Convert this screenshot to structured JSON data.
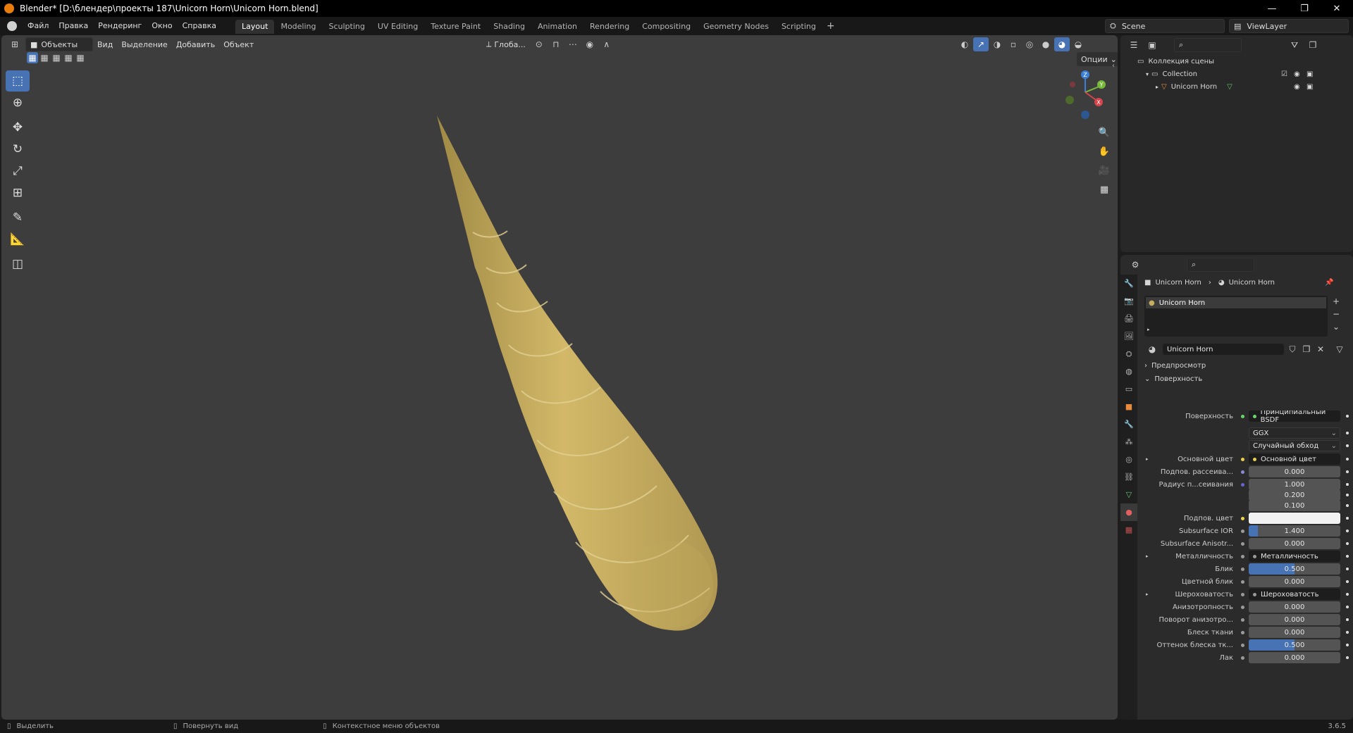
{
  "title": "Blender* [D:\\блендер\\проекты 187\\Unicorn Horn\\Unicorn Horn.blend]",
  "window_buttons": [
    "—",
    "❐",
    "✕"
  ],
  "menu": [
    "Файл",
    "Правка",
    "Рендеринг",
    "Окно",
    "Справка"
  ],
  "workspaces": [
    "Layout",
    "Modeling",
    "Sculpting",
    "UV Editing",
    "Texture Paint",
    "Shading",
    "Animation",
    "Rendering",
    "Compositing",
    "Geometry Nodes",
    "Scripting"
  ],
  "add_workspace": "+",
  "scene": "Scene",
  "view_layer": "ViewLayer",
  "viewport": {
    "mode": "Объекты",
    "menus": [
      "Вид",
      "Выделение",
      "Добавить",
      "Объект"
    ],
    "transform_orientation": "Глоба...",
    "options": "Опции",
    "gizmo_axes": [
      "X",
      "Y",
      "Z"
    ],
    "horn_color": "#c7ad5f"
  },
  "outliner": {
    "scene_collection": "Коллекция сцены",
    "collection": "Collection",
    "object": "Unicorn Horn"
  },
  "properties": {
    "breadcrumb_object": "Unicorn Horn",
    "breadcrumb_material": "Unicorn Horn",
    "slot": "Unicorn Horn",
    "material_name": "Unicorn Horn",
    "preview_panel": "Предпросмотр",
    "surface_panel": "Поверхность",
    "rows": [
      {
        "label": "Поверхность",
        "value": "Принципиальный BSDF",
        "kind": "link",
        "sock": "#6bd36b"
      },
      {
        "label": "",
        "value": "GGX",
        "kind": "select"
      },
      {
        "label": "",
        "value": "Случайный обход",
        "kind": "select"
      },
      {
        "label": "Основной цвет",
        "value": "Основной цвет",
        "kind": "link",
        "sock": "#e8d24a",
        "expand": true
      },
      {
        "label": "Подпов. рассеива...",
        "value": "0.000",
        "kind": "num",
        "sock": "#8a8ad6"
      },
      {
        "label": "Радиус п...сеивания",
        "value": "1.000",
        "kind": "num",
        "sock": "#6565d0"
      },
      {
        "label": "",
        "value": "0.200",
        "kind": "num"
      },
      {
        "label": "",
        "value": "0.100",
        "kind": "num"
      },
      {
        "label": "Подпов. цвет",
        "value": "",
        "kind": "color",
        "sock": "#e8d24a"
      },
      {
        "label": "Subsurface IOR",
        "value": "1.400",
        "kind": "num",
        "sock": "#9a9a9a",
        "fill": 0.1
      },
      {
        "label": "Subsurface Anisotr...",
        "value": "0.000",
        "kind": "num",
        "sock": "#9a9a9a"
      },
      {
        "label": "Металличность",
        "value": "Металличность",
        "kind": "link",
        "sock": "#9a9a9a",
        "expand": true
      },
      {
        "label": "Блик",
        "value": "0.500",
        "kind": "num",
        "sock": "#9a9a9a",
        "fill": 0.5
      },
      {
        "label": "Цветной блик",
        "value": "0.000",
        "kind": "num",
        "sock": "#9a9a9a"
      },
      {
        "label": "Шероховатость",
        "value": "Шероховатость",
        "kind": "link",
        "sock": "#9a9a9a",
        "expand": true
      },
      {
        "label": "Анизотропность",
        "value": "0.000",
        "kind": "num",
        "sock": "#9a9a9a"
      },
      {
        "label": "Поворот анизотро...",
        "value": "0.000",
        "kind": "num",
        "sock": "#9a9a9a"
      },
      {
        "label": "Блеск ткани",
        "value": "0.000",
        "kind": "num",
        "sock": "#9a9a9a"
      },
      {
        "label": "Оттенок блеска тк...",
        "value": "0.500",
        "kind": "num",
        "sock": "#9a9a9a",
        "fill": 0.5
      },
      {
        "label": "Лак",
        "value": "0.000",
        "kind": "num",
        "sock": "#9a9a9a"
      }
    ]
  },
  "status": {
    "select": "Выделить",
    "rotate": "Повернуть вид",
    "context": "Контекстное меню объектов",
    "version": "3.6.5"
  }
}
